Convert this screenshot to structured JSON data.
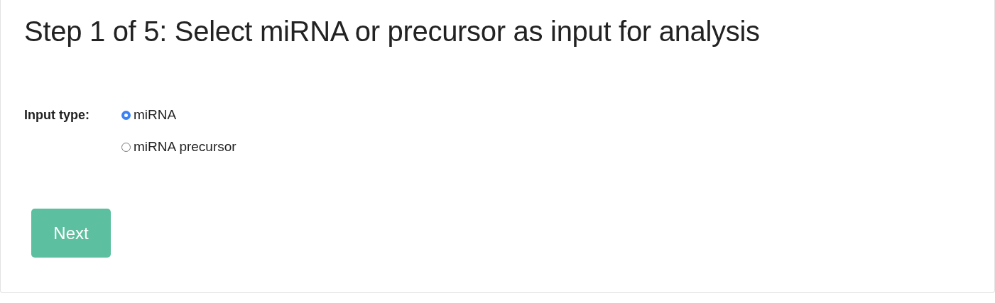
{
  "title": "Step 1 of 5: Select miRNA or precursor as input for analysis",
  "input_type": {
    "label": "Input type:",
    "options": [
      {
        "label": "miRNA",
        "selected": true
      },
      {
        "label": "miRNA precursor",
        "selected": false
      }
    ]
  },
  "buttons": [
    "Next"
  ]
}
